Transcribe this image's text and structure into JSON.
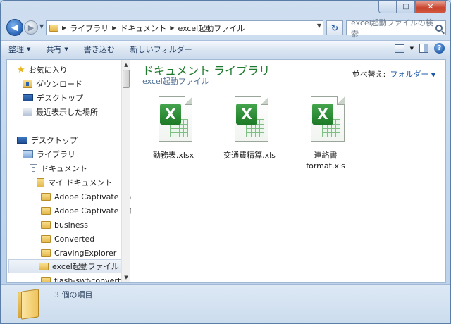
{
  "window": {
    "caption": {
      "minimize": "─",
      "maximize": "□",
      "close": "✕"
    }
  },
  "address": {
    "back_glyph": "◀",
    "forward_glyph": "▶",
    "crumbs": [
      "ライブラリ",
      "ドキュメント",
      "excel起動ファイル"
    ],
    "refresh_glyph": "↻",
    "search_placeholder": "excel起動ファイルの検索"
  },
  "toolbar": {
    "organize": "整理",
    "share": "共有",
    "burn": "書き込む",
    "new_folder": "新しいフォルダー"
  },
  "nav": {
    "favorites": "お気に入り",
    "downloads": "ダウンロード",
    "desktop_fav": "デスクトップ",
    "recent": "最近表示した場所",
    "desktop": "デスクトップ",
    "libraries": "ライブラリ",
    "documents": "ドキュメント",
    "my_documents": "マイ ドキュメント",
    "folders": [
      "Adobe Captivate Ca",
      "Adobe Captivate プロ",
      "business",
      "Converted",
      "CravingExplorer",
      "excel起動ファイル",
      "flash-swf-converter"
    ],
    "selected_index": 5
  },
  "content": {
    "library_title": "ドキュメント ライブラリ",
    "library_subtitle": "excel起動ファイル",
    "arrange_label": "並べ替え:",
    "arrange_value": "フォルダー",
    "files": [
      {
        "name_line1": "勤務表.xlsx",
        "name_line2": ""
      },
      {
        "name_line1": "交通費精算.xls",
        "name_line2": ""
      },
      {
        "name_line1": "連絡書",
        "name_line2": "format.xls"
      }
    ],
    "icon_letter": "X"
  },
  "details": {
    "item_count": "3 個の項目"
  }
}
